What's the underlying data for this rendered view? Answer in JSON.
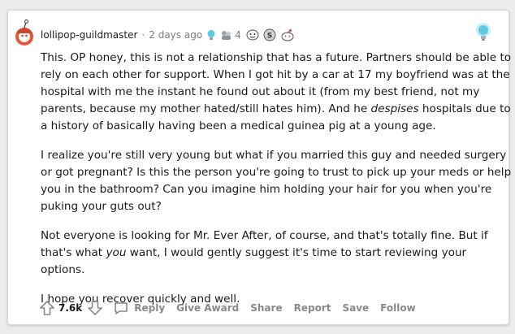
{
  "comment": {
    "username": "lollipop-guildmaster",
    "separator": "·",
    "timestamp": "2 days ago",
    "award_count": "4",
    "paragraphs": [
      {
        "parts": [
          {
            "text": "This. OP honey, this is not a relationship that has a future. Partners should be able to rely on each other for support. When I got hit by a car at 17 my boyfriend was at the hospital with me the instant he found out about it (from my best friend, not my parents, because my mother hated/still hates him). And he ",
            "em": false
          },
          {
            "text": "despises",
            "em": true
          },
          {
            "text": " hospitals due to a history of basically having been a medical guinea pig at a young age.",
            "em": false
          }
        ]
      },
      {
        "parts": [
          {
            "text": "I realize you're still very young but what if you married this guy and needed surgery or got pregnant? Is this the person you're going to trust to pick up your meds or help you in the bathroom? Can you imagine him holding your hair for you when you're puking your guts out?",
            "em": false
          }
        ]
      },
      {
        "parts": [
          {
            "text": "Not everyone is looking for Mr. Ever After, of course, and that's totally fine. But if that's what ",
            "em": false
          },
          {
            "text": "you",
            "em": true
          },
          {
            "text": " want, I would gently suggest it's time to start reviewing your options.",
            "em": false
          }
        ]
      },
      {
        "parts": [
          {
            "text": "I hope you recover quickly and well.",
            "em": false
          }
        ]
      }
    ]
  },
  "actions": {
    "vote_count": "7.6k",
    "reply": "Reply",
    "give_award": "Give Award",
    "share": "Share",
    "report": "Report",
    "save": "Save",
    "follow": "Follow"
  },
  "icons": {
    "avatar": "snoo-avatar-icon",
    "helpful_award": "lightbulb-award-icon",
    "group_award": "group-award-icon",
    "silver_award": "silver-award-icon",
    "wholesome_award": "wholesome-award-icon",
    "upvote": "upvote-arrow-icon",
    "downvote": "downvote-arrow-icon",
    "reply": "speech-bubble-icon"
  },
  "colors": {
    "username": "#1c1c1c",
    "muted": "#7c7c7c",
    "action": "#878a8c",
    "award_blue": "#5ec8e5",
    "avatar_orange": "#e8563a"
  }
}
